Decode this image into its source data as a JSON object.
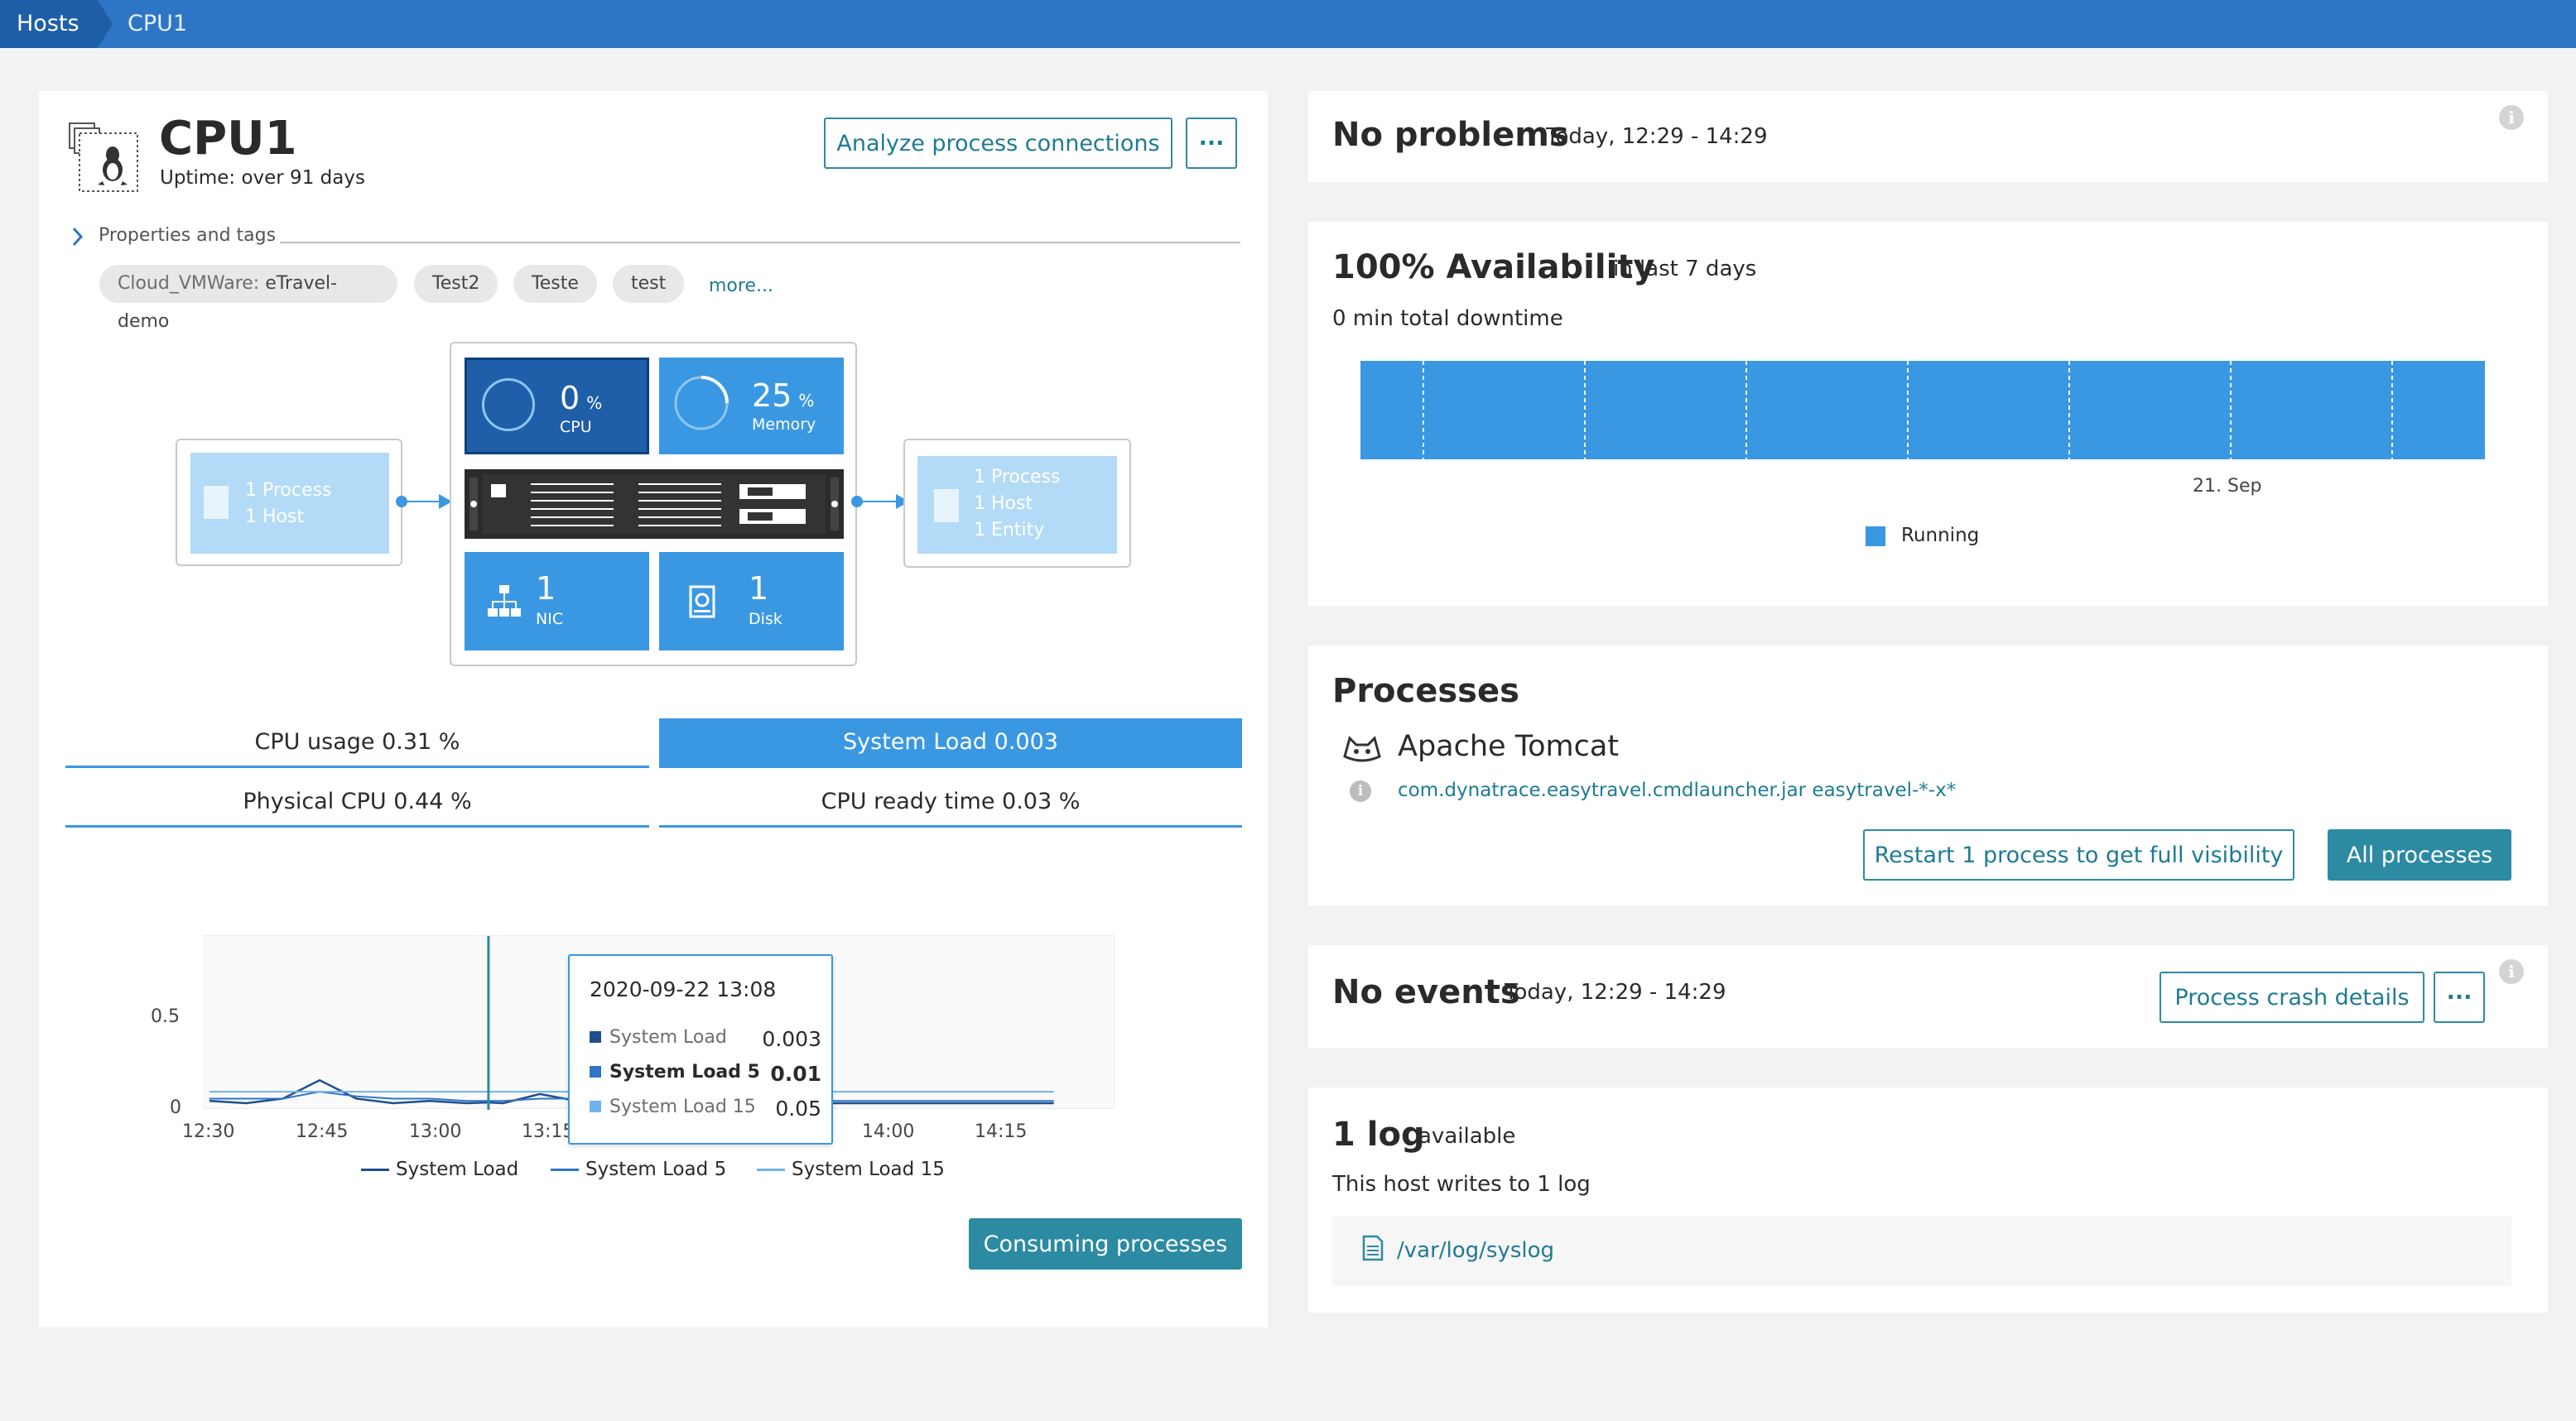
{
  "breadcrumb": {
    "hosts": "Hosts",
    "current": "CPU1"
  },
  "host": {
    "name": "CPU1",
    "uptime": "Uptime: over 91 days",
    "analyze_label": "Analyze process connections",
    "more_label": "···",
    "properties_label": "Properties and tags",
    "tags": {
      "cloud_key": "Cloud_VMWare:",
      "cloud_val": "eTravel-demo",
      "t1": "Test2",
      "t2": "Teste",
      "t3": "test"
    },
    "more_tags": "more..."
  },
  "topology": {
    "left": {
      "line1": "1 Process",
      "line2": "1 Host"
    },
    "right": {
      "line1": "1 Process",
      "line2": "1 Host",
      "line3": "1 Entity"
    },
    "cpu": {
      "value": "0",
      "unit": "%",
      "label": "CPU"
    },
    "memory": {
      "value": "25",
      "unit": "%",
      "label": "Memory",
      "fraction": 0.25
    },
    "nic": {
      "value": "1",
      "label": "NIC"
    },
    "disk": {
      "value": "1",
      "label": "Disk"
    }
  },
  "metric_tabs": {
    "cpu_usage": "CPU usage 0.31 %",
    "system_load": "System Load 0.003",
    "physical_cpu": "Physical CPU 0.44 %",
    "cpu_ready": "CPU ready time 0.03 %"
  },
  "chart": {
    "y_ticks": [
      "0.5",
      "0"
    ],
    "x_ticks": [
      "12:30",
      "12:45",
      "13:00",
      "13:15",
      "14:00",
      "14:15"
    ],
    "legend": [
      "System Load",
      "System Load 5",
      "System Load 15"
    ],
    "tooltip": {
      "time": "2020-09-22 13:08",
      "rows": [
        {
          "name": "System Load",
          "value": "0.003"
        },
        {
          "name": "System Load 5",
          "value": "0.01"
        },
        {
          "name": "System Load 15",
          "value": "0.05"
        }
      ]
    },
    "consuming_label": "Consuming processes",
    "colors": {
      "load": "#1f4f8f",
      "load5": "#2f75c6",
      "load15": "#6fb3ea"
    }
  },
  "chart_data": {
    "type": "line",
    "x": [
      "12:30",
      "12:35",
      "12:40",
      "12:45",
      "12:50",
      "12:55",
      "13:00",
      "13:05",
      "13:08",
      "13:10",
      "13:15",
      "13:20",
      "13:30",
      "13:40",
      "13:50",
      "14:00",
      "14:10",
      "14:20",
      "14:25"
    ],
    "series": [
      {
        "name": "System Load",
        "values": [
          0.01,
          0.0,
          0.02,
          0.1,
          0.02,
          0.0,
          0.01,
          0.0,
          0.003,
          0.0,
          0.04,
          0.01,
          0.0,
          0.0,
          0.0,
          0.0,
          0.0,
          0.0,
          0.0
        ]
      },
      {
        "name": "System Load 5",
        "values": [
          0.02,
          0.02,
          0.02,
          0.05,
          0.03,
          0.02,
          0.02,
          0.01,
          0.01,
          0.01,
          0.02,
          0.02,
          0.01,
          0.01,
          0.01,
          0.01,
          0.01,
          0.01,
          0.01
        ]
      },
      {
        "name": "System Load 15",
        "values": [
          0.05,
          0.05,
          0.05,
          0.05,
          0.05,
          0.05,
          0.05,
          0.05,
          0.05,
          0.05,
          0.05,
          0.05,
          0.05,
          0.05,
          0.05,
          0.05,
          0.05,
          0.05,
          0.05
        ]
      }
    ],
    "ylim": [
      0,
      0.7
    ],
    "grid": false,
    "legend": "bottom"
  },
  "problems": {
    "title": "No problems",
    "time": "Today, 12:29 - 14:29"
  },
  "availability": {
    "title": "100% Availability",
    "range": "in last 7 days",
    "downtime": "0 min total downtime",
    "date_label": "21. Sep",
    "legend": "Running",
    "color": "#3a98e2"
  },
  "processes": {
    "title": "Processes",
    "name": "Apache Tomcat",
    "cmd": "com.dynatrace.easytravel.cmdlauncher.jar easytravel-*-x*",
    "restart_label": "Restart 1 process to get full visibility",
    "all_label": "All processes"
  },
  "events": {
    "title": "No events",
    "time": "Today, 12:29 - 14:29",
    "crash_label": "Process crash details",
    "more_label": "···"
  },
  "logs": {
    "title": "1 log",
    "available": "available",
    "desc": "This host writes to 1 log",
    "path": "/var/log/syslog"
  }
}
